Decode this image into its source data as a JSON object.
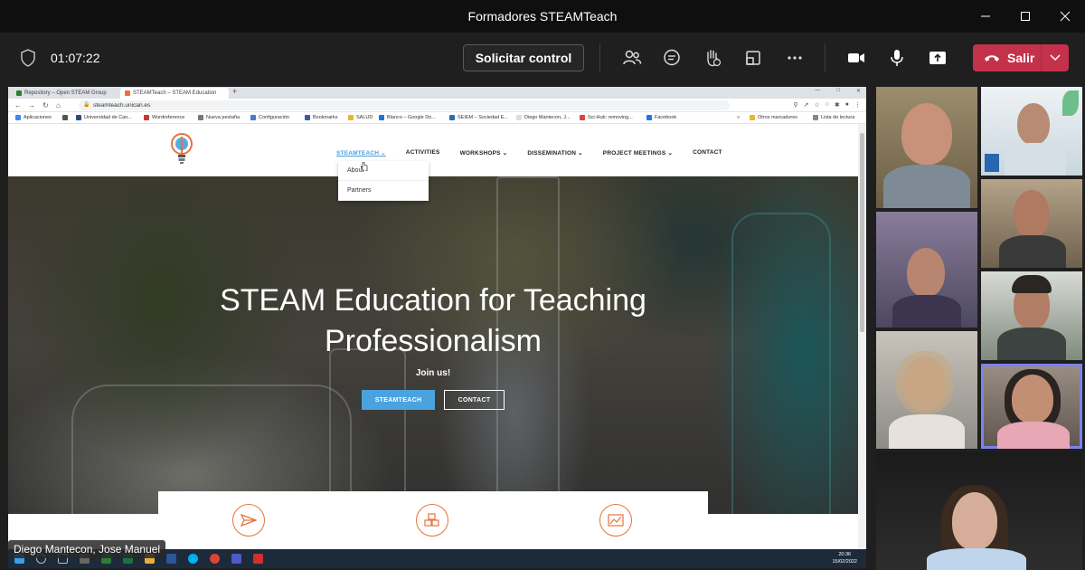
{
  "window": {
    "title": "Formadores STEAMTeach",
    "controls": [
      "minimize-icon",
      "maximize-icon",
      "close-icon"
    ]
  },
  "toolbar": {
    "timer": "01:07:22",
    "request_control": "Solicitar control",
    "leave": "Salir",
    "icons": [
      "people-icon",
      "chat-icon",
      "raise-hand-icon",
      "rooms-icon",
      "more-icon",
      "camera-icon",
      "mic-icon",
      "share-icon"
    ]
  },
  "browser": {
    "tabs": [
      {
        "label": "Repository – Open STEAM Group",
        "color": "#2f7d32"
      },
      {
        "label": "STEAMTeach – STEAM Education",
        "color": "#e8733a"
      }
    ],
    "url": "steamteach.unican.es",
    "bookmarks": [
      "Aplicaciones",
      "Universidad de Can...",
      "Wordreference",
      "Nueva pestaña",
      "Configuración",
      "Bookmarks",
      "SALUD",
      "Blanco – Google Do...",
      "SEIEM – Sociedad E...",
      "Diego Mantecon, J...",
      "Sci-Hub: removing...",
      "Facebook",
      "Otros marcadores",
      "Lista de lectura"
    ]
  },
  "site": {
    "nav": [
      "STEAMTEACH ⌄",
      "ACTIVITIES",
      "WORKSHOPS ⌄",
      "DISSEMINATION ⌄",
      "PROJECT MEETINGS ⌄",
      "CONTACT"
    ],
    "dropdown": [
      "About",
      "Partners"
    ],
    "hero_title_line1": "STEAM Education for Teaching",
    "hero_title_line2": "Professionalism",
    "join": "Join us!",
    "btn_primary": "STEAMTEACH",
    "btn_secondary": "CONTACT"
  },
  "taskbar": {
    "time": "20:36",
    "date": "15/02/2022"
  },
  "presenter_label": "Diego Mantecon, Jose Manuel",
  "colors": {
    "accent": "#c4314b",
    "link": "#4aa3df",
    "brand_orange": "#e8733a",
    "active_speaker": "#7b83eb"
  }
}
